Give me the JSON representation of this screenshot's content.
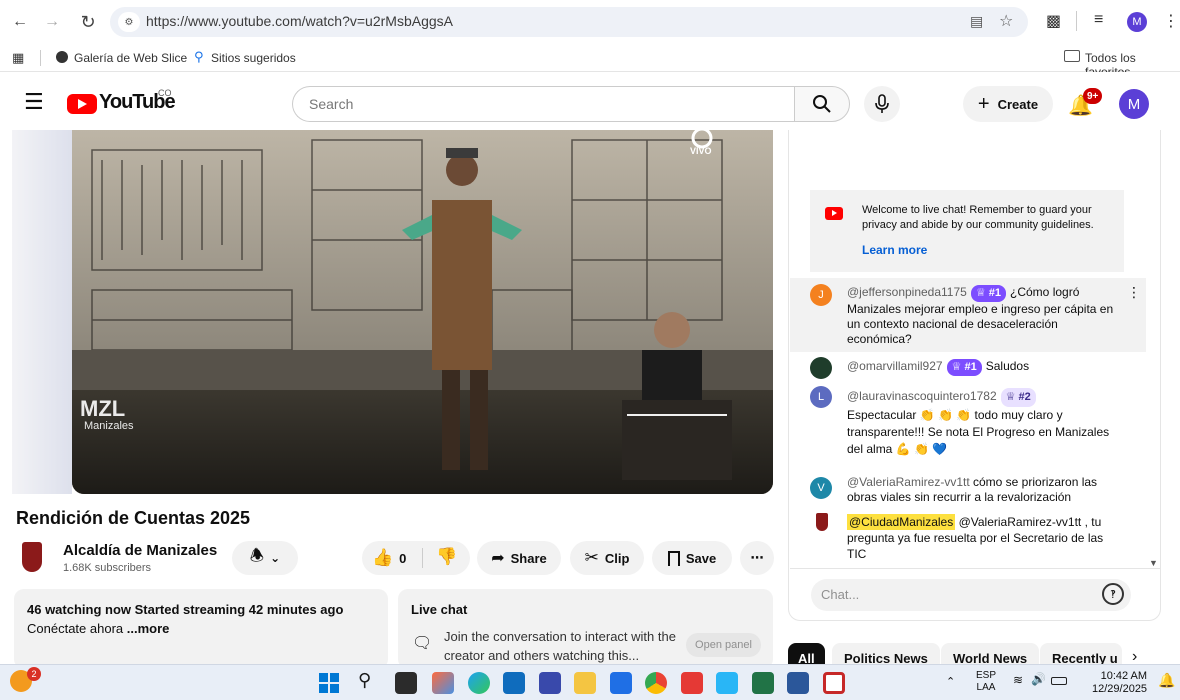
{
  "browser": {
    "url": "https://www.youtube.com/watch?v=u2rMsbAggsA",
    "profile_initial": "M",
    "bookmarks": [
      {
        "label": "Galería de Web Slice"
      },
      {
        "label": "Sitios sugeridos"
      }
    ],
    "all_bookmarks_label": "Todos los favoritos"
  },
  "header": {
    "logo_text": "YouTube",
    "country_code": "CO",
    "search_placeholder": "Search",
    "create_label": "Create",
    "notifications_badge": "9+",
    "avatar_initial": "M"
  },
  "video": {
    "title": "Rendición de Cuentas 2025",
    "live_label": "VIVO",
    "watermark": "MZL",
    "watermark_sub": "Manizales"
  },
  "channel": {
    "name": "Alcaldía de Manizales",
    "subscribers": "1.68K subscribers"
  },
  "actions": {
    "like_count": "0",
    "share_label": "Share",
    "clip_label": "Clip",
    "save_label": "Save"
  },
  "description": {
    "stats": "46 watching now  Started streaming 42 minutes ago",
    "text": "Conéctate ahora",
    "more": "...more"
  },
  "live_chat_card": {
    "title": "Live chat",
    "text": "Join the conversation to interact with the creator and others watching this...",
    "button": "Open panel"
  },
  "chat": {
    "welcome": "Welcome to live chat! Remember to guard your privacy and abide by our community guidelines.",
    "learn_more": "Learn more",
    "messages": [
      {
        "author": "@jeffersonpineda1175",
        "badge": "#1",
        "text": "¿Cómo logró Manizales mejorar empleo e ingreso per cápita en un contexto nacional de desaceleración económica?",
        "initial": "J",
        "color": "#f4811f"
      },
      {
        "author": "@omarvillamil927",
        "badge": "#1",
        "text": "Saludos",
        "initial": "",
        "color": "#1f3d2b"
      },
      {
        "author": "@lauravinascoquintero1782",
        "badge": "#2",
        "text": "Espectacular 👏 👏 👏 todo muy claro y transparente!!! Se nota El Progreso en Manizales del alma 💪 👏 💙",
        "initial": "L",
        "color": "#5c6bc0"
      },
      {
        "author": "@ValeriaRamirez-vv1tt",
        "badge": "",
        "text": "cómo se priorizaron las obras viales sin recurrir a la revalorización",
        "initial": "V",
        "color": "#1e88a8"
      },
      {
        "author": "@CiudadManizales",
        "badge": "",
        "text": "@ValeriaRamirez-vv1tt , tu pregunta ya fue resuelta por el Secretario de las TIC",
        "initial": "",
        "color": "#8b1a1a"
      }
    ],
    "input_placeholder": "Chat..."
  },
  "chips": [
    "All",
    "Politics News",
    "World News",
    "Recently u"
  ],
  "taskbar": {
    "lang": "ESP",
    "lang_sub": "LAA",
    "time": "10:42 AM",
    "date": "12/29/2025",
    "notif_count": "2"
  },
  "colors": {
    "youtube_red": "#ff0000",
    "badge_purple": "#7c4dff",
    "link_blue": "#065fd4",
    "highlight_yellow": "#fde03f"
  }
}
